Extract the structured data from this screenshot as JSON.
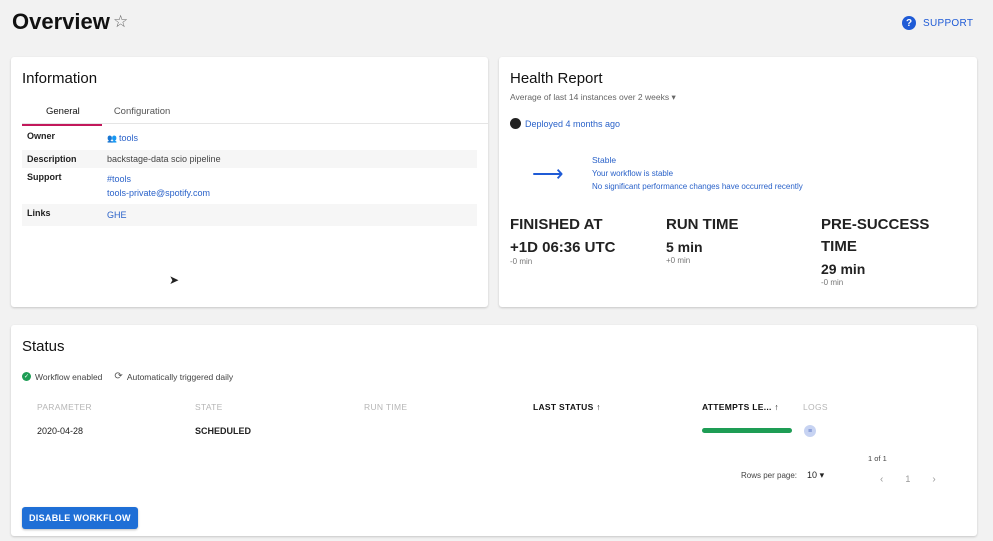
{
  "header": {
    "title": "Overview",
    "support_label": "SUPPORT"
  },
  "information": {
    "title": "Information",
    "tabs": [
      {
        "label": "General",
        "active": true
      },
      {
        "label": "Configuration",
        "active": false
      }
    ],
    "rows": [
      {
        "key": "Owner",
        "value": "tools"
      },
      {
        "key": "Description",
        "value": "backstage-data scio pipeline"
      },
      {
        "key": "Support",
        "values": [
          "#tools",
          "tools-private@spotify.com"
        ]
      },
      {
        "key": "Links",
        "value": "GHE"
      }
    ]
  },
  "health": {
    "title": "Health Report",
    "subtitle": "Average of last 14 instances over 2 weeks",
    "deployed": "Deployed 4 months ago",
    "status_title": "Stable",
    "status_line1": "Your workflow is stable",
    "status_line2": "No significant performance changes have occurred recently",
    "metrics": [
      {
        "label": "FINISHED AT",
        "value": "+1D 06:36 UTC",
        "delta": "-0 min"
      },
      {
        "label": "RUN TIME",
        "value": "5 min",
        "delta": "+0 min"
      },
      {
        "label": "PRE-SUCCESS TIME",
        "value": "29 min",
        "delta": "-0 min"
      }
    ]
  },
  "status": {
    "title": "Status",
    "badge_enabled": "Workflow enabled",
    "badge_trigger": "Automatically triggered daily",
    "columns": [
      "PARAMETER",
      "STATE",
      "RUN TIME",
      "LAST STATUS",
      "ATTEMPTS LE...",
      "LOGS"
    ],
    "rows": [
      {
        "parameter": "2020-04-28",
        "state": "SCHEDULED",
        "attempts_fraction": 1.0
      }
    ],
    "pagination": {
      "page_of": "1 of 1",
      "rows_per_page_label": "Rows per page:",
      "rows_per_page": "10",
      "page": "1"
    },
    "disable_button": "DISABLE WORKFLOW"
  },
  "colors": {
    "accent": "#1f5bd6",
    "tab_indicator": "#c2185b",
    "success": "#1e9d55"
  }
}
